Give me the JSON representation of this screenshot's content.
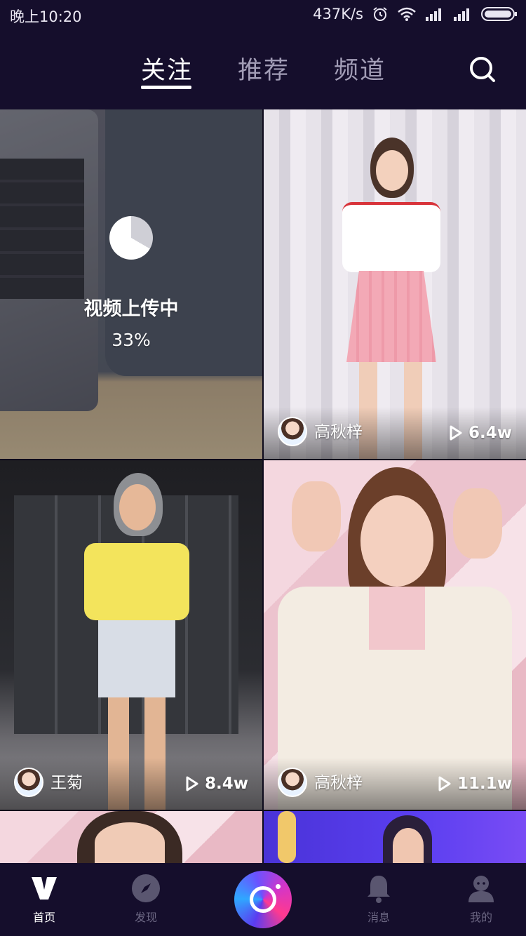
{
  "status_bar": {
    "time": "晚上10:20",
    "network_speed": "437K/s",
    "icons": [
      "alarm-icon",
      "wifi-icon",
      "signal-icon",
      "signal-icon",
      "battery-icon"
    ]
  },
  "top_nav": {
    "tabs": [
      {
        "label": "关注",
        "active": true
      },
      {
        "label": "推荐",
        "active": false
      },
      {
        "label": "频道",
        "active": false
      }
    ],
    "search_icon": "search-icon"
  },
  "feed": {
    "upload_card": {
      "label": "视频上传中",
      "progress_text": "33%",
      "progress": 0.33
    },
    "cards": [
      {
        "author": "高秋梓",
        "views": "6.4w"
      },
      {
        "author": "王菊",
        "views": "8.4w"
      },
      {
        "author": "高秋梓",
        "views": "11.1w"
      }
    ]
  },
  "bottom_nav": {
    "items": [
      {
        "label": "首页",
        "icon": "v-logo-icon",
        "active": true
      },
      {
        "label": "发现",
        "icon": "compass-icon",
        "active": false
      },
      {
        "label": "",
        "icon": "camera-record-icon",
        "active": false
      },
      {
        "label": "消息",
        "icon": "bell-icon",
        "active": false
      },
      {
        "label": "我的",
        "icon": "person-icon",
        "active": false
      }
    ]
  },
  "colors": {
    "background": "#150e2c",
    "active_text": "#ffffff",
    "inactive_text": "#a29db6"
  }
}
